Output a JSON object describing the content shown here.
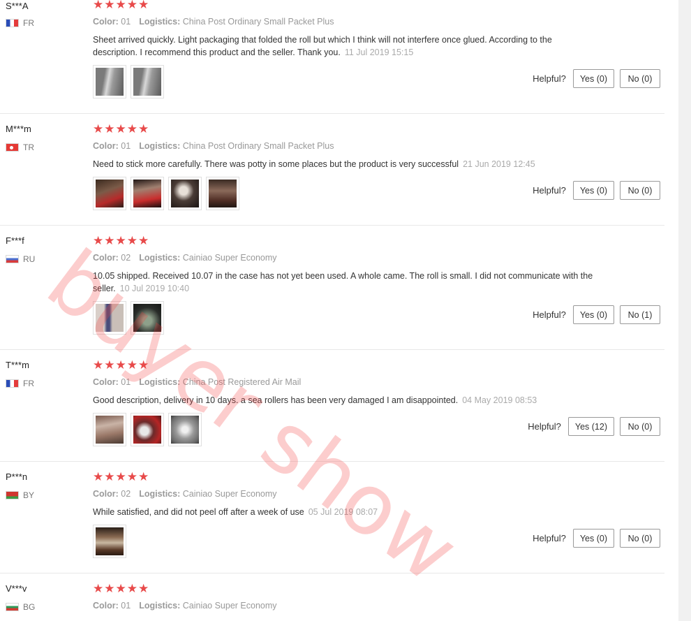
{
  "stars_glyph": "★★★★★",
  "color_label": "Color:",
  "logistics_label": "Logistics:",
  "helpful_label": "Helpful?",
  "watermark": "buyer show",
  "reviews": [
    {
      "user": "S***A",
      "country": "FR",
      "color": "01",
      "logistics": "China Post Ordinary Small Packet Plus",
      "comment": "Sheet arrived quickly. Light packaging that folded the roll but which I think will not interfere once glued. According to the description. I recommend this product and the seller. Thank you.",
      "date": "11 Jul 2019 15:15",
      "yes": "Yes (0)",
      "no": "No (0)"
    },
    {
      "user": "M***m",
      "country": "TR",
      "color": "01",
      "logistics": "China Post Ordinary Small Packet Plus",
      "comment": "Need to stick more carefully. There was potty in some places but the product is very successful",
      "date": "21 Jun 2019 12:45",
      "yes": "Yes (0)",
      "no": "No (0)"
    },
    {
      "user": "F***f",
      "country": "RU",
      "color": "02",
      "logistics": "Cainiao Super Economy",
      "comment": "10.05 shipped. Received 10.07 in the case has not yet been used. A whole came. The roll is small. I did not communicate with the seller.",
      "date": "10 Jul 2019 10:40",
      "yes": "Yes (0)",
      "no": "No (1)"
    },
    {
      "user": "T***m",
      "country": "FR",
      "color": "01",
      "logistics": "China Post Registered Air Mail",
      "comment": "Good description, delivery in 10 days. a sea rollers has been very damaged I am disappointed.",
      "date": "04 May 2019 08:53",
      "yes": "Yes (12)",
      "no": "No (0)"
    },
    {
      "user": "P***n",
      "country": "BY",
      "color": "02",
      "logistics": "Cainiao Super Economy",
      "comment": "While satisfied, and did not peel off after a week of use",
      "date": "05 Jul 2019 08:07",
      "yes": "Yes (0)",
      "no": "No (0)"
    },
    {
      "user": "V***v",
      "country": "BG",
      "color": "01",
      "logistics": "Cainiao Super Economy"
    }
  ]
}
